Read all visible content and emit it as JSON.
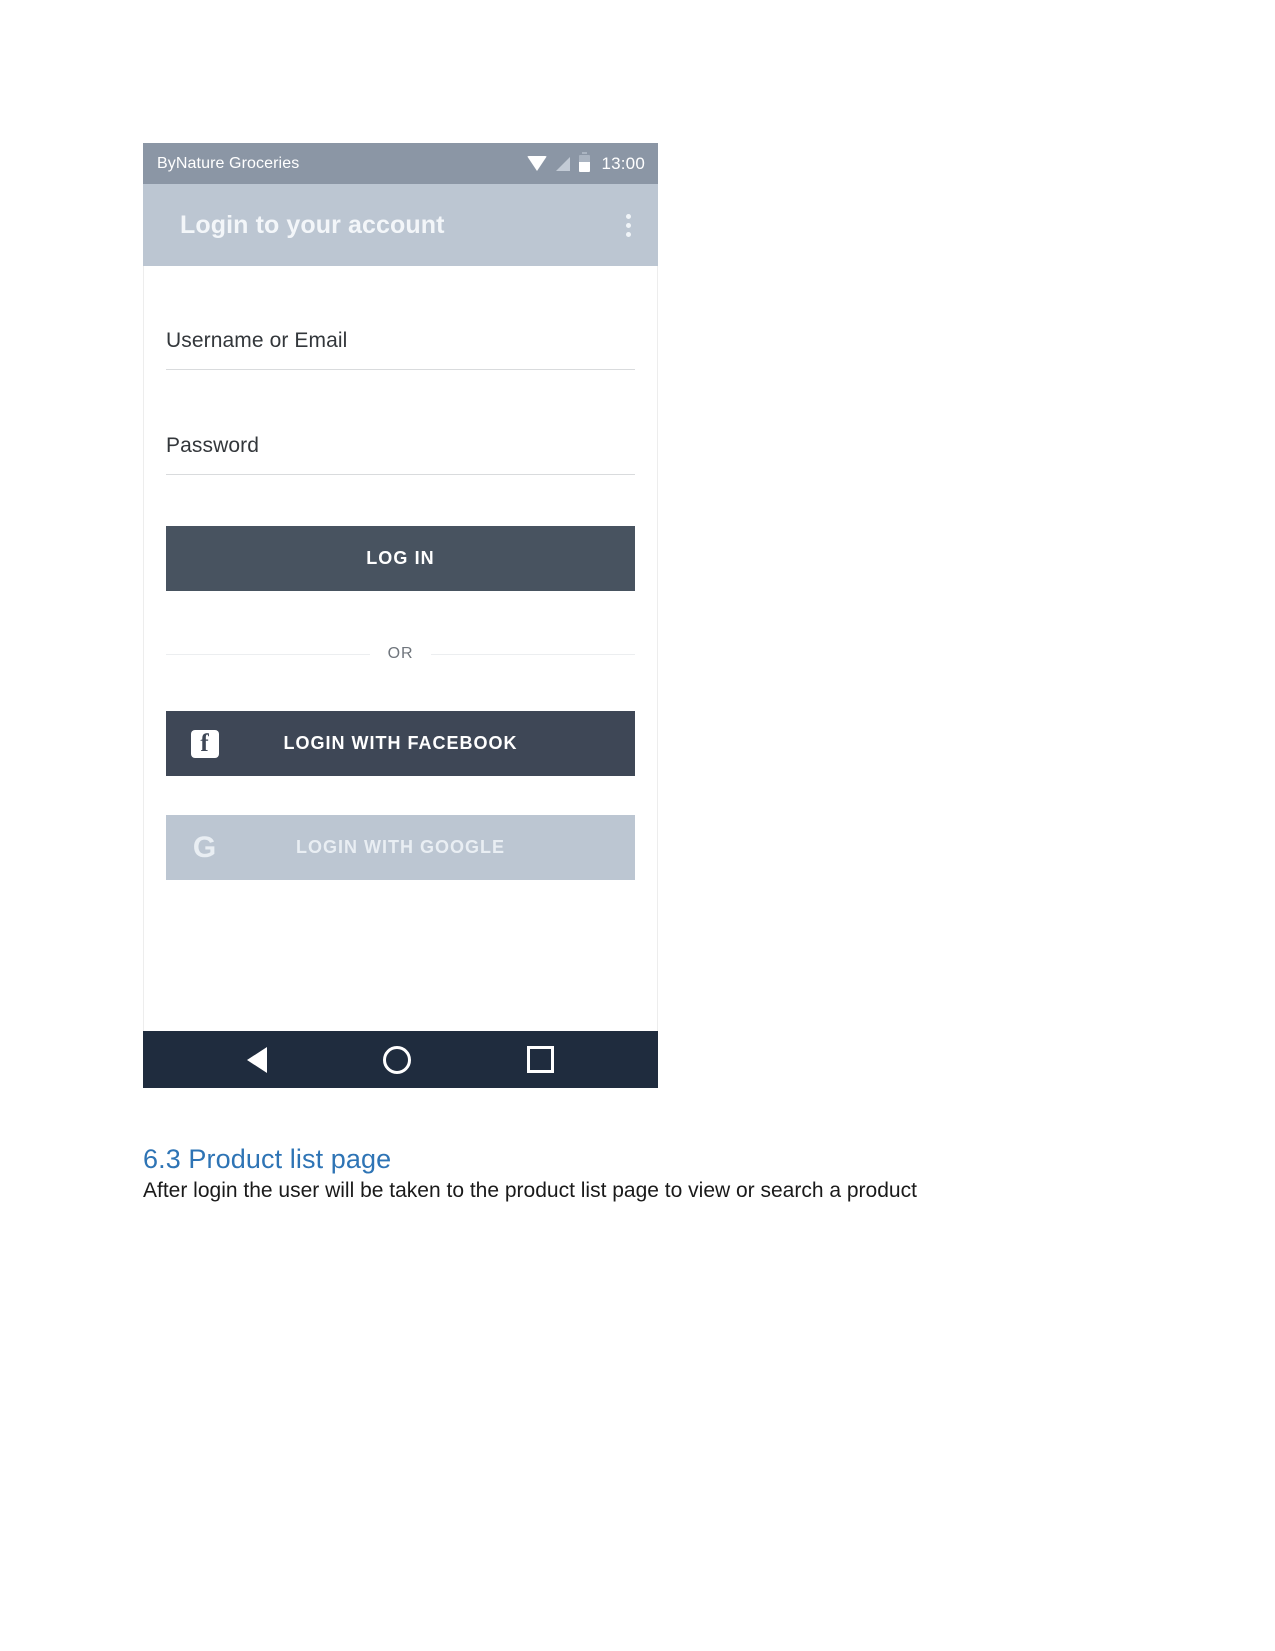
{
  "document": {
    "heading": "6.3 Product list page",
    "paragraph": "After login the user will be taken to the product list page to view or search a product",
    "heading_color": "#2E74B5"
  },
  "phone": {
    "status_bar": {
      "app_name": "ByNature Groceries",
      "time": "13:00",
      "icons": [
        "wifi-icon",
        "cellular-signal-icon",
        "battery-icon"
      ],
      "background_color": "#8B96A5"
    },
    "app_bar": {
      "title": "Login to your account",
      "overflow_menu": "more-options-icon",
      "background_color": "#BCC6D2"
    },
    "form": {
      "username_field": {
        "label": "Username or Email",
        "value": "",
        "placeholder": "Username or Email"
      },
      "password_field": {
        "label": "Password",
        "value": "",
        "placeholder": "Password"
      },
      "login_button": "LOG IN",
      "login_button_color": "#485360",
      "divider_text": "OR",
      "facebook_button": "LOGIN WITH FACEBOOK",
      "facebook_button_color": "#3E4756",
      "facebook_icon_letter": "f",
      "google_button": "LOGIN WITH GOOGLE",
      "google_button_color": "#BCC6D2",
      "google_icon_letter": "G"
    },
    "nav_bar": {
      "back": "back-nav-icon",
      "home": "home-nav-icon",
      "recents": "recents-nav-icon",
      "background_color": "#1F2C3E"
    }
  }
}
